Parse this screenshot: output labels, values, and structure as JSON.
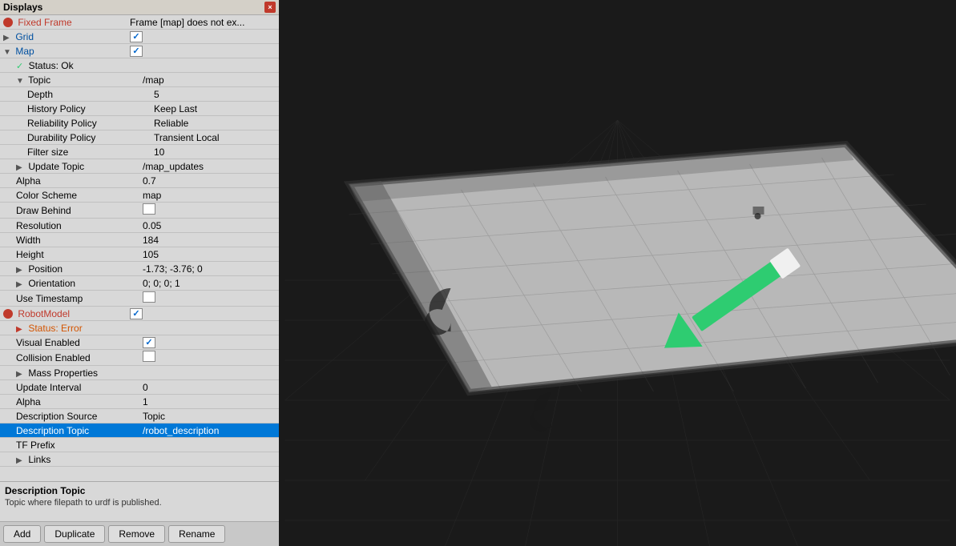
{
  "displays_panel": {
    "title": "Displays",
    "close_btn": "×",
    "rows": [
      {
        "id": "fixed-frame",
        "indent": 0,
        "icon": "red-circle",
        "label": "Fixed Frame",
        "value": "Frame [map] does not ex...",
        "label_class": "text-red",
        "expand": false
      },
      {
        "id": "grid",
        "indent": 0,
        "icon": "expand",
        "label": "Grid",
        "value": "",
        "label_class": "text-blue",
        "has_checkbox": true,
        "checkbox_checked": true
      },
      {
        "id": "map",
        "indent": 0,
        "icon": "expand",
        "label": "Map",
        "value": "",
        "label_class": "text-blue",
        "has_checkbox": true,
        "checkbox_checked": true
      },
      {
        "id": "status-ok",
        "indent": 1,
        "icon": "green-check",
        "label": "Status: Ok",
        "value": ""
      },
      {
        "id": "topic",
        "indent": 1,
        "icon": "expand-right",
        "label": "Topic",
        "value": "/map"
      },
      {
        "id": "depth",
        "indent": 2,
        "label": "Depth",
        "value": "5"
      },
      {
        "id": "history-policy",
        "indent": 2,
        "label": "History Policy",
        "value": "Keep Last"
      },
      {
        "id": "reliability-policy",
        "indent": 2,
        "label": "Reliability Policy",
        "value": "Reliable"
      },
      {
        "id": "durability-policy",
        "indent": 2,
        "label": "Durability Policy",
        "value": "Transient Local"
      },
      {
        "id": "filter-size",
        "indent": 2,
        "label": "Filter size",
        "value": "10"
      },
      {
        "id": "update-topic",
        "indent": 1,
        "icon": "expand-right",
        "label": "Update Topic",
        "value": "/map_updates"
      },
      {
        "id": "alpha",
        "indent": 1,
        "label": "Alpha",
        "value": "0.7"
      },
      {
        "id": "color-scheme",
        "indent": 1,
        "label": "Color Scheme",
        "value": "map"
      },
      {
        "id": "draw-behind",
        "indent": 1,
        "label": "Draw Behind",
        "value": "",
        "has_checkbox": true,
        "checkbox_checked": false
      },
      {
        "id": "resolution",
        "indent": 1,
        "label": "Resolution",
        "value": "0.05"
      },
      {
        "id": "width",
        "indent": 1,
        "label": "Width",
        "value": "184"
      },
      {
        "id": "height",
        "indent": 1,
        "label": "Height",
        "value": "105"
      },
      {
        "id": "position",
        "indent": 1,
        "icon": "expand-right",
        "label": "Position",
        "value": "-1.73; -3.76; 0"
      },
      {
        "id": "orientation",
        "indent": 1,
        "icon": "expand-right",
        "label": "Orientation",
        "value": "0; 0; 0; 1"
      },
      {
        "id": "use-timestamp",
        "indent": 1,
        "label": "Use Timestamp",
        "value": "",
        "has_checkbox": true,
        "checkbox_checked": false
      },
      {
        "id": "robot-model",
        "indent": 0,
        "icon": "red-circle",
        "label": "RobotModel",
        "value": "",
        "label_class": "text-red",
        "has_checkbox": true,
        "checkbox_checked": true
      },
      {
        "id": "status-error",
        "indent": 1,
        "icon": "expand-red",
        "label": "Status: Error",
        "value": "",
        "label_class": "text-orange"
      },
      {
        "id": "visual-enabled",
        "indent": 1,
        "label": "Visual Enabled",
        "value": "",
        "has_checkbox": true,
        "checkbox_checked": true
      },
      {
        "id": "collision-enabled",
        "indent": 1,
        "label": "Collision Enabled",
        "value": "",
        "has_checkbox": true,
        "checkbox_checked": false
      },
      {
        "id": "mass-properties",
        "indent": 1,
        "icon": "expand-right",
        "label": "Mass Properties",
        "value": ""
      },
      {
        "id": "update-interval",
        "indent": 1,
        "label": "Update Interval",
        "value": "0"
      },
      {
        "id": "alpha2",
        "indent": 1,
        "label": "Alpha",
        "value": "1"
      },
      {
        "id": "description-source",
        "indent": 1,
        "label": "Description Source",
        "value": "Topic"
      },
      {
        "id": "description-topic",
        "indent": 1,
        "label": "Description Topic",
        "value": "/robot_description",
        "selected": true
      },
      {
        "id": "tf-prefix",
        "indent": 1,
        "label": "TF Prefix",
        "value": ""
      },
      {
        "id": "links",
        "indent": 1,
        "icon": "expand-right",
        "label": "Links",
        "value": ""
      }
    ],
    "info_title": "Description Topic",
    "info_text": "Topic where filepath to urdf is published.",
    "buttons": [
      "Add",
      "Duplicate",
      "Remove",
      "Rename"
    ]
  },
  "scene": {
    "background_color": "#1a1a1a"
  }
}
